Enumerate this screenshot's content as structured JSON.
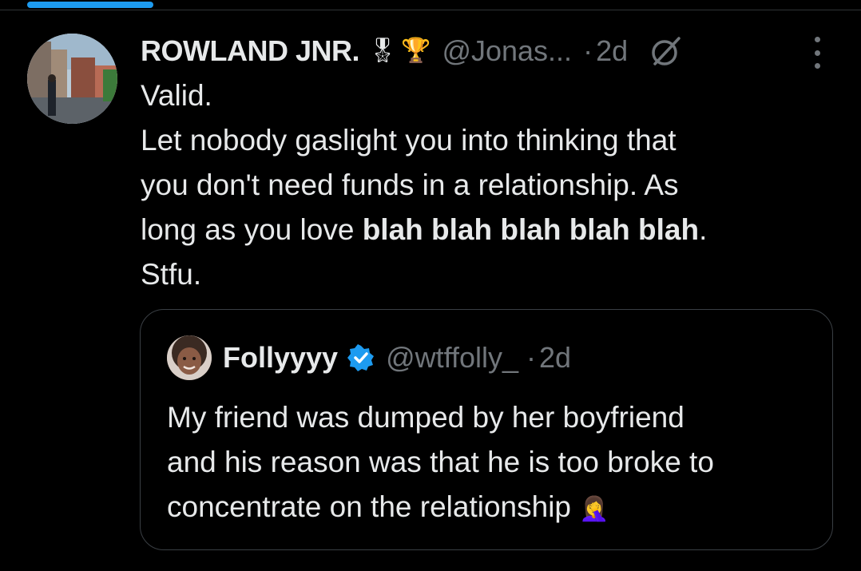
{
  "tweet": {
    "author_name": "ROWLAND JNR.",
    "badges": [
      "🎖",
      "🏆"
    ],
    "handle": "@Jonas...",
    "dot": "·",
    "time": "2d",
    "text_lines": [
      "Valid.",
      "Let nobody gaslight you into thinking that",
      "you don't need funds in a relationship. As",
      "long as you love ",
      "Stfu."
    ],
    "bold_phrase": "blah blah blah blah blah",
    "after_bold": ".",
    "icons": [
      "grok-icon",
      "more-icon"
    ]
  },
  "quote": {
    "author_name": "Follyyyy",
    "verified": true,
    "handle": "@wtffolly_",
    "dot": "·",
    "time": "2d",
    "text_lines": [
      "My friend was dumped by her boyfriend",
      "and his reason was that he is too broke to",
      "concentrate on the relationship "
    ],
    "trailing_emoji": "🤦‍♀️"
  },
  "colors": {
    "background": "#000000",
    "text": "#e7e9ea",
    "muted": "#71767b",
    "accent": "#1d9bf0",
    "border": "#3a3f44"
  }
}
